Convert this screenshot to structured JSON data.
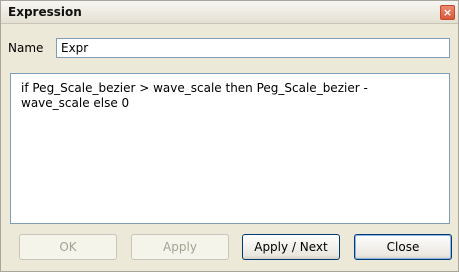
{
  "window": {
    "title": "Expression"
  },
  "name_field": {
    "label": "Name",
    "value": "Expr"
  },
  "expression": {
    "text": "if Peg_Scale_bezier > wave_scale then Peg_Scale_bezier - wave_scale else 0"
  },
  "buttons": {
    "ok": "OK",
    "apply": "Apply",
    "apply_next": "Apply / Next",
    "close": "Close"
  },
  "icons": {
    "close": "close-icon"
  },
  "colors": {
    "dialog_bg": "#ece9d8",
    "close_button": "#d9573a",
    "field_border": "#7f9db9"
  }
}
